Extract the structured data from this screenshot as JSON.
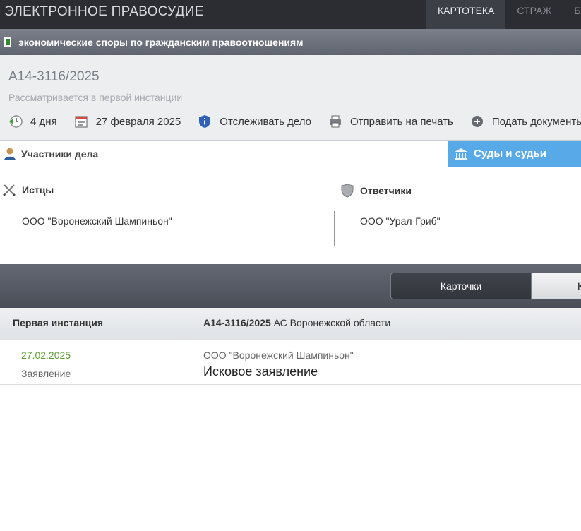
{
  "header": {
    "brand": "ЭЛЕКТРОННОЕ ПРАВОСУДИЕ",
    "nav": [
      "КАРТОТЕКА",
      "СТРАЖ",
      "Б"
    ]
  },
  "category": {
    "label": "экономические споры по гражданским правоотношениям"
  },
  "case": {
    "number": "А14-3116/2025",
    "status": "Рассматривается в первой инстанции",
    "actions": {
      "days": "4 дня",
      "date": "27 февраля 2025",
      "track": "Отслеживать дело",
      "print": "Отправить на печать",
      "submit": "Подать документы"
    }
  },
  "tabs": {
    "participants": "Участники дела",
    "courts": "Суды и судьи"
  },
  "participants": {
    "plaintiffs_label": "Истцы",
    "plaintiff": "ООО \"Воронежский Шампиньон\"",
    "defendants_label": "Ответчики",
    "defendant": "ООО \"Урал-Гриб\""
  },
  "view_buttons": {
    "cards": "Карточки",
    "next": "К"
  },
  "instance": {
    "label": "Первая инстанция",
    "case_no": "А14-3116/2025",
    "court": "АС Воронежской области"
  },
  "document": {
    "date": "27.02.2025",
    "type": "Заявление",
    "party": "ООО \"Воронежский Шампиньон\"",
    "title": "Исковое заявление"
  },
  "colors": {
    "accent": "#58a9e8",
    "date_green": "#5d9b2f",
    "topbar": "#2b2d33"
  }
}
